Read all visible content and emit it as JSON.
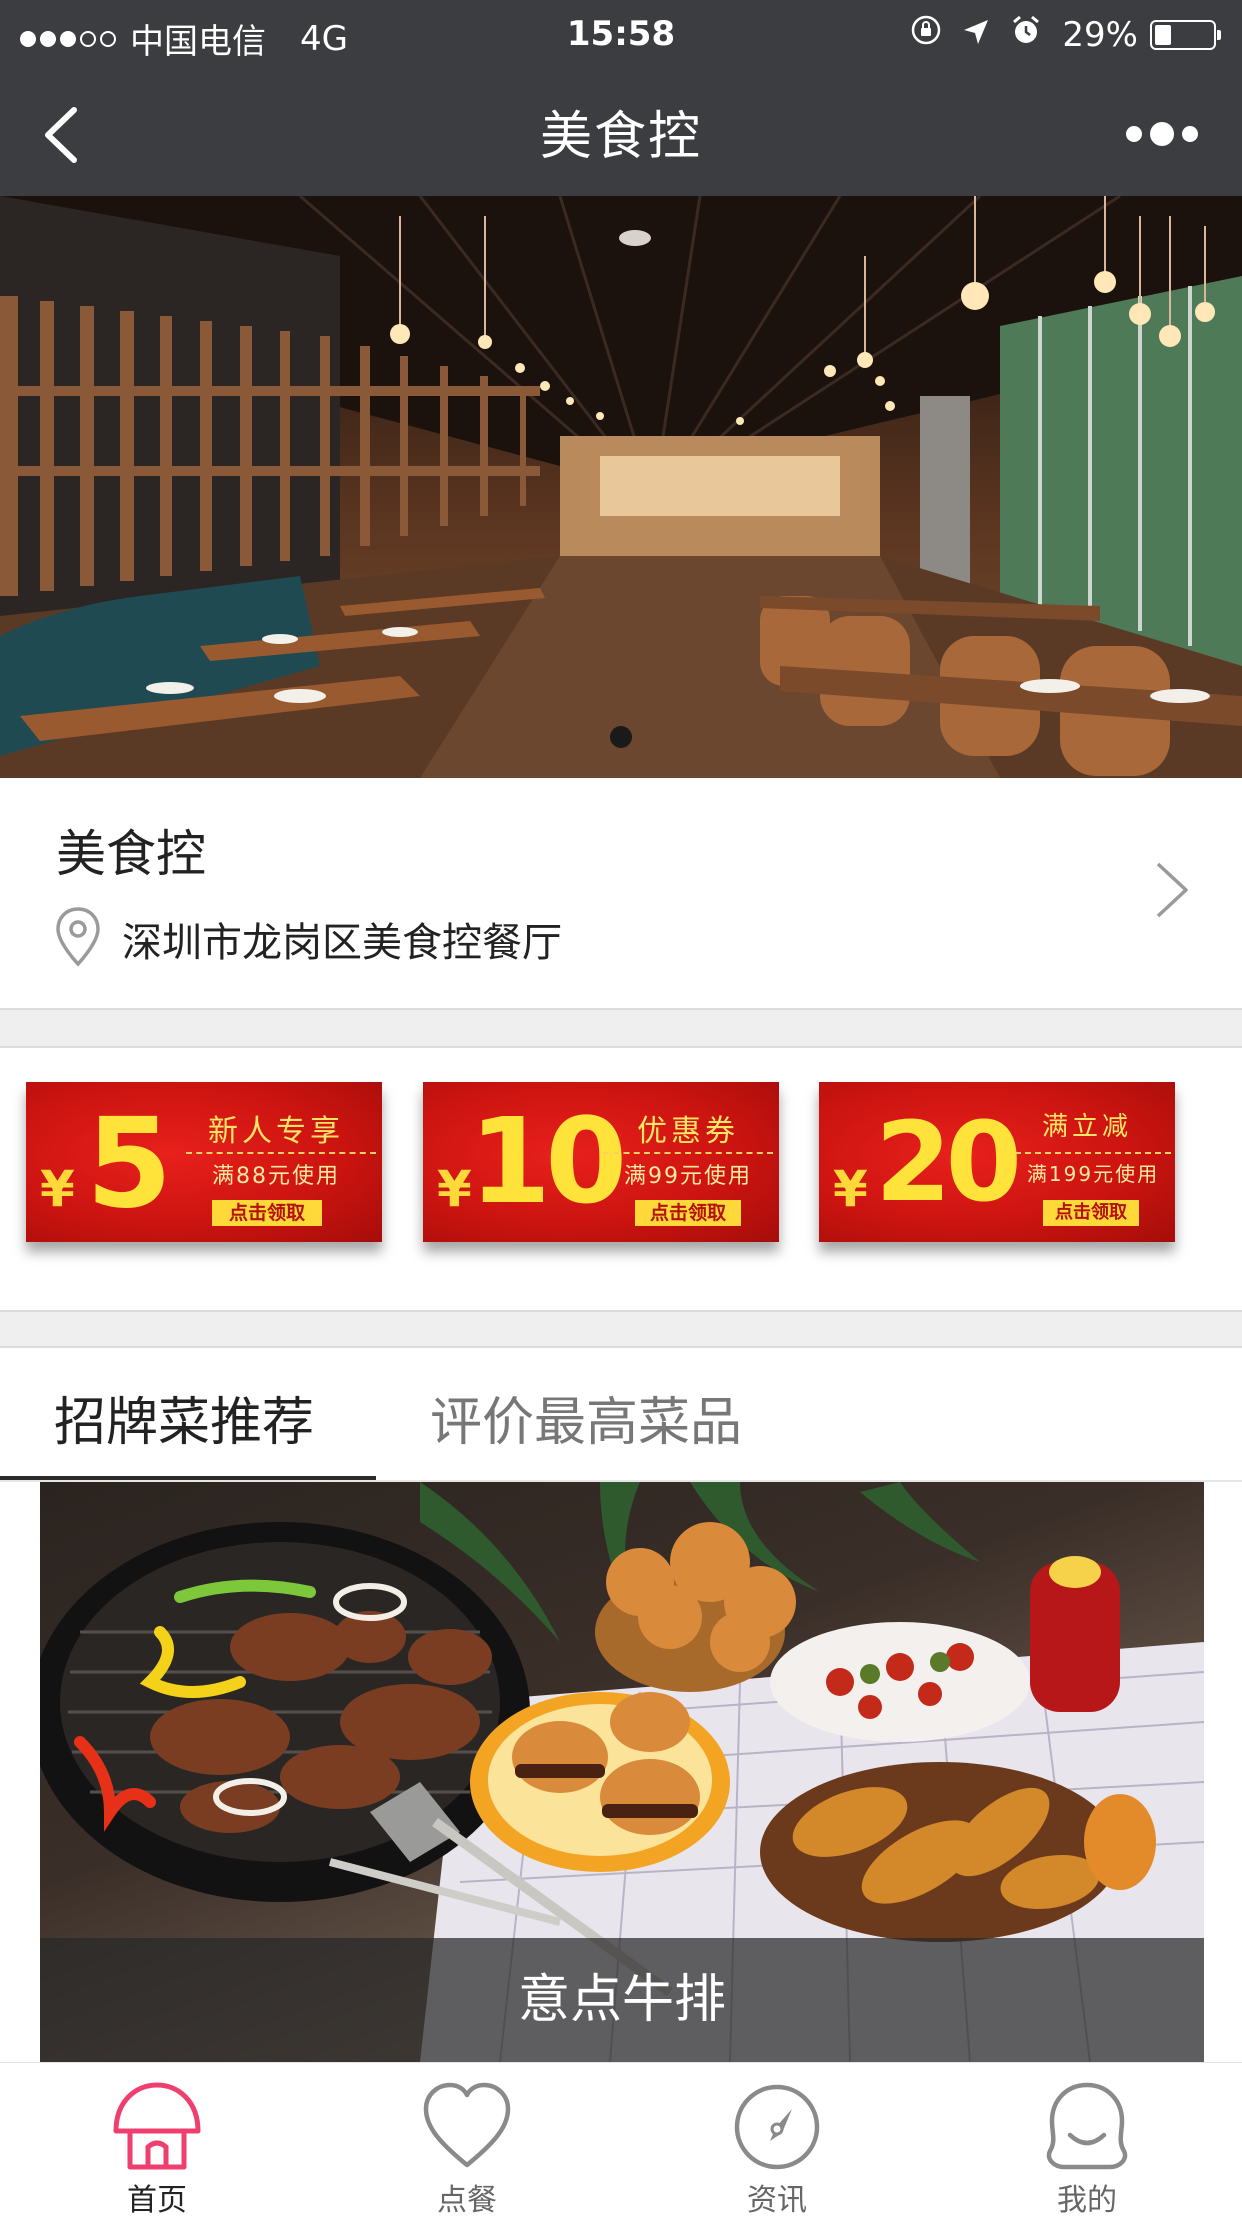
{
  "status_bar": {
    "signal_dots": [
      "full",
      "full",
      "full",
      "empty",
      "empty"
    ],
    "carrier": "中国电信",
    "network": "4G",
    "time": "15:58",
    "icons": [
      "rotation-lock-icon",
      "location-arrow-icon",
      "alarm-icon"
    ],
    "battery_percent": "29%",
    "battery_level": 0.29
  },
  "nav": {
    "back_icon": "chevron-left-icon",
    "title": "美食控",
    "more_icon": "more-dots-icon"
  },
  "banner": {
    "image": "restaurant-interior-photo",
    "pager_dots": 1,
    "active_dot": 0
  },
  "restaurant": {
    "name": "美食控",
    "address_icon": "location-pin-icon",
    "address": "深圳市龙岗区美食控餐厅",
    "chevron_icon": "chevron-right-icon"
  },
  "coupons": [
    {
      "currency": "¥",
      "amount": "5",
      "title": "新人专享",
      "condition": "满88元使用",
      "button": "点击领取"
    },
    {
      "currency": "¥",
      "amount": "10",
      "title": "优惠券",
      "condition": "满99元使用",
      "button": "点击领取"
    },
    {
      "currency": "¥",
      "amount": "20",
      "title": "满立减",
      "condition": "满199元使用",
      "button": "点击领取"
    }
  ],
  "tabs": [
    {
      "label": "招牌菜推荐",
      "active": true
    },
    {
      "label": "评价最高菜品",
      "active": false
    }
  ],
  "featured_dish": {
    "image": "grilled-food-spread-photo",
    "caption": "意点牛排"
  },
  "tab_bar": [
    {
      "label": "首页",
      "icon": "home-mushroom-icon",
      "active": true,
      "color": "#ef3f6f"
    },
    {
      "label": "点餐",
      "icon": "heart-icon",
      "active": false,
      "color": "#888888"
    },
    {
      "label": "资讯",
      "icon": "compass-icon",
      "active": false,
      "color": "#888888"
    },
    {
      "label": "我的",
      "icon": "user-bubble-icon",
      "active": false,
      "color": "#888888"
    }
  ],
  "colors": {
    "bar_background": "#3b3d40",
    "coupon_red": "#cc1410",
    "coupon_yellow": "#ffe23a",
    "active_tab_icon": "#ef3f6f"
  }
}
